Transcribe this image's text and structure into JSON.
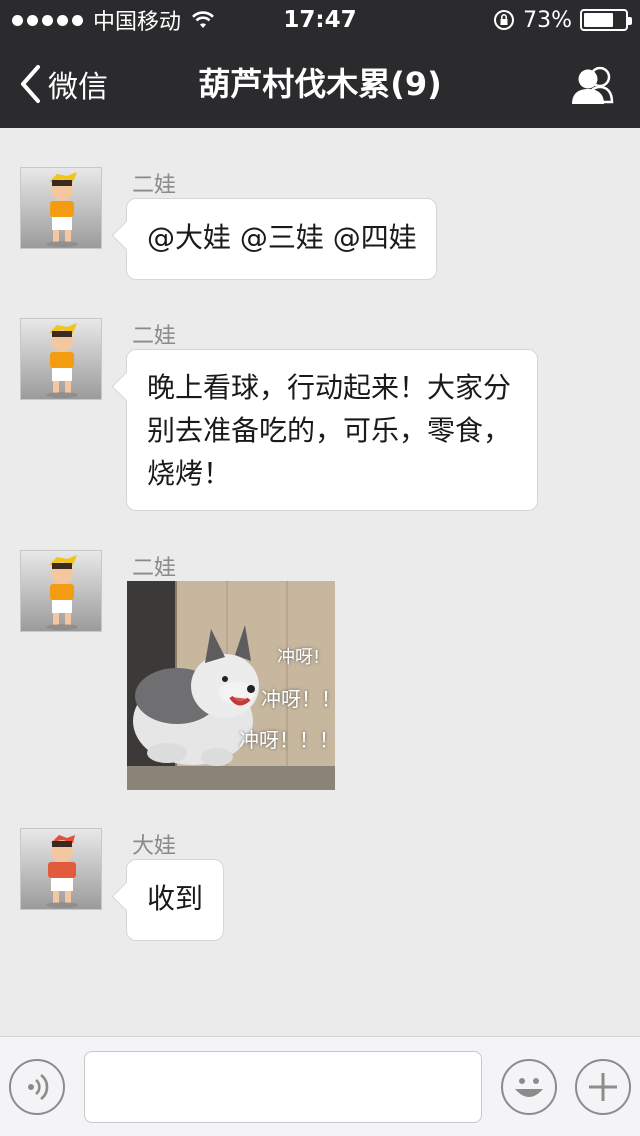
{
  "status_bar": {
    "carrier": "中国移动",
    "time": "17:47",
    "battery_percent": "73%",
    "battery_level": 0.73,
    "signal_dots": 5
  },
  "nav": {
    "back_label": "微信",
    "title": "葫芦村伐木累(9)"
  },
  "messages": [
    {
      "sender": "二娃",
      "text": "@大娃 @三娃 @四娃"
    },
    {
      "sender": "二娃",
      "lines": [
        "晚上看球，行动起来！大家分",
        "别去准备吃的，可乐，零食，",
        "烧烤！"
      ]
    },
    {
      "sender": "二娃",
      "image_captions": [
        "冲呀!",
        "冲呀！！",
        "冲呀！！！"
      ]
    },
    {
      "sender": "大娃",
      "text": "收到"
    }
  ],
  "input_bar": {
    "placeholder": ""
  },
  "colors": {
    "bar_bg": "#2b2b2e",
    "chat_bg": "#ebebeb",
    "bubble_bg": "#ffffff"
  }
}
